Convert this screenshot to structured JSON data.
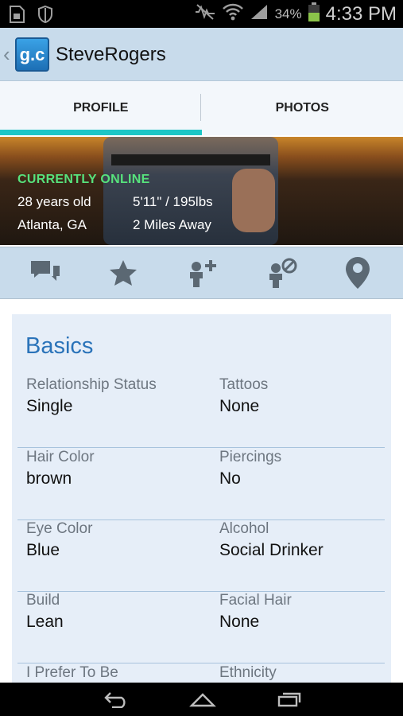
{
  "status_bar": {
    "battery_percent": "34%",
    "time": "4:33 PM",
    "icons": [
      "sd-card-icon",
      "shield-icon",
      "mute-icon",
      "wifi-icon",
      "signal-icon",
      "battery-icon"
    ]
  },
  "header": {
    "logo_text": "g.c",
    "title": "SteveRogers"
  },
  "tabs": [
    {
      "label": "PROFILE",
      "active": true
    },
    {
      "label": "PHOTOS",
      "active": false
    }
  ],
  "hero": {
    "status": "CURRENTLY ONLINE",
    "age": "28 years old",
    "height_weight": "5'11\" / 195lbs",
    "location": "Atlanta, GA",
    "distance": "2 Miles Away"
  },
  "actions": [
    {
      "name": "chat",
      "icon": "chat-bubbles-icon"
    },
    {
      "name": "favorite",
      "icon": "star-icon"
    },
    {
      "name": "add-friend",
      "icon": "add-person-icon"
    },
    {
      "name": "block",
      "icon": "block-person-icon"
    },
    {
      "name": "location",
      "icon": "location-pin-icon"
    }
  ],
  "basics": {
    "title": "Basics",
    "rows": [
      {
        "left": {
          "label": "Relationship Status",
          "value": "Single"
        },
        "right": {
          "label": "Tattoos",
          "value": "None"
        }
      },
      {
        "left": {
          "label": "Hair Color",
          "value": "brown"
        },
        "right": {
          "label": "Piercings",
          "value": "No"
        }
      },
      {
        "left": {
          "label": "Eye Color",
          "value": "Blue"
        },
        "right": {
          "label": "Alcohol",
          "value": "Social Drinker"
        }
      },
      {
        "left": {
          "label": "Build",
          "value": "Lean"
        },
        "right": {
          "label": "Facial Hair",
          "value": "None"
        }
      },
      {
        "left": {
          "label": "I Prefer To Be",
          "value": ""
        },
        "right": {
          "label": "Ethnicity",
          "value": ""
        }
      }
    ]
  },
  "colors": {
    "accent": "#1dc6c6",
    "online": "#57e27c",
    "title_blue": "#2a73b9",
    "bar_blue": "#c8dbeb"
  }
}
